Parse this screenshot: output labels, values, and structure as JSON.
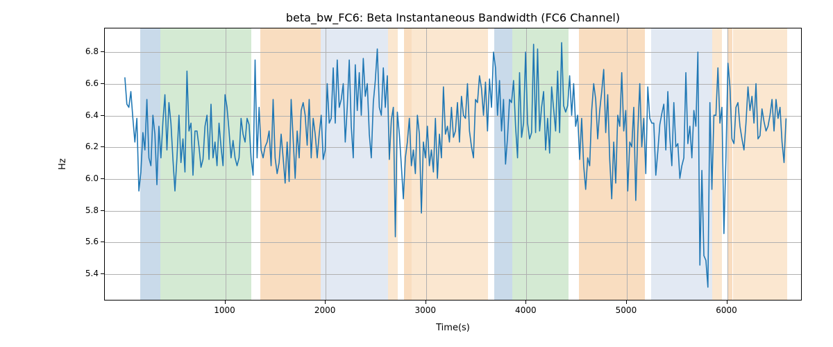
{
  "chart_data": {
    "type": "line",
    "title": "beta_bw_FC6: Beta Instantaneous Bandwidth (FC6 Channel)",
    "xlabel": "Time(s)",
    "ylabel": "Hz",
    "xlim": [
      -200,
      6750
    ],
    "ylim": [
      5.23,
      6.95
    ],
    "xticks": [
      1000,
      2000,
      3000,
      4000,
      5000,
      6000
    ],
    "yticks": [
      5.4,
      5.6,
      5.8,
      6.0,
      6.2,
      6.4,
      6.6,
      6.8
    ],
    "bands": [
      {
        "start": 150,
        "end": 350,
        "color": "#c9daea"
      },
      {
        "start": 350,
        "end": 1260,
        "color": "#d4ead3"
      },
      {
        "start": 1350,
        "end": 1950,
        "color": "#f9ddc0"
      },
      {
        "start": 1950,
        "end": 2620,
        "color": "#e2e9f3"
      },
      {
        "start": 2620,
        "end": 2720,
        "color": "#fbe7d0"
      },
      {
        "start": 2780,
        "end": 2860,
        "color": "#f9ddc0"
      },
      {
        "start": 2860,
        "end": 3620,
        "color": "#fbe7d0"
      },
      {
        "start": 3680,
        "end": 3860,
        "color": "#c9daea"
      },
      {
        "start": 3860,
        "end": 4420,
        "color": "#d4ead3"
      },
      {
        "start": 4520,
        "end": 5180,
        "color": "#f9ddc0"
      },
      {
        "start": 5240,
        "end": 5850,
        "color": "#e2e9f3"
      },
      {
        "start": 5850,
        "end": 5950,
        "color": "#fbe7d0"
      },
      {
        "start": 6010,
        "end": 6055,
        "color": "#f9ddc0"
      },
      {
        "start": 6055,
        "end": 6600,
        "color": "#fbe7d0"
      }
    ],
    "x": [
      0,
      20,
      40,
      60,
      80,
      100,
      120,
      140,
      160,
      180,
      200,
      220,
      240,
      260,
      280,
      300,
      320,
      340,
      360,
      380,
      400,
      420,
      440,
      460,
      480,
      500,
      520,
      540,
      560,
      580,
      600,
      620,
      640,
      660,
      680,
      700,
      720,
      740,
      760,
      780,
      800,
      820,
      840,
      860,
      880,
      900,
      920,
      940,
      960,
      980,
      1000,
      1020,
      1040,
      1060,
      1080,
      1100,
      1120,
      1140,
      1160,
      1180,
      1200,
      1220,
      1240,
      1260,
      1280,
      1300,
      1320,
      1340,
      1360,
      1380,
      1400,
      1420,
      1440,
      1460,
      1480,
      1500,
      1520,
      1540,
      1560,
      1580,
      1600,
      1620,
      1640,
      1660,
      1680,
      1700,
      1720,
      1740,
      1760,
      1780,
      1800,
      1820,
      1840,
      1860,
      1880,
      1900,
      1920,
      1940,
      1960,
      1980,
      2000,
      2020,
      2040,
      2060,
      2080,
      2100,
      2120,
      2140,
      2160,
      2180,
      2200,
      2220,
      2240,
      2260,
      2280,
      2300,
      2320,
      2340,
      2360,
      2380,
      2400,
      2420,
      2440,
      2460,
      2480,
      2500,
      2520,
      2540,
      2560,
      2580,
      2600,
      2620,
      2640,
      2660,
      2680,
      2700,
      2720,
      2740,
      2760,
      2780,
      2800,
      2820,
      2840,
      2860,
      2880,
      2900,
      2920,
      2940,
      2960,
      2980,
      3000,
      3020,
      3040,
      3060,
      3080,
      3100,
      3120,
      3140,
      3160,
      3180,
      3200,
      3220,
      3240,
      3260,
      3280,
      3300,
      3320,
      3340,
      3360,
      3380,
      3400,
      3420,
      3440,
      3460,
      3480,
      3500,
      3520,
      3540,
      3560,
      3580,
      3600,
      3620,
      3640,
      3660,
      3680,
      3700,
      3720,
      3740,
      3760,
      3780,
      3800,
      3820,
      3840,
      3860,
      3880,
      3900,
      3920,
      3940,
      3960,
      3980,
      4000,
      4020,
      4040,
      4060,
      4080,
      4100,
      4120,
      4140,
      4160,
      4180,
      4200,
      4220,
      4240,
      4260,
      4280,
      4300,
      4320,
      4340,
      4360,
      4380,
      4400,
      4420,
      4440,
      4460,
      4480,
      4500,
      4520,
      4540,
      4560,
      4580,
      4600,
      4620,
      4640,
      4660,
      4680,
      4700,
      4720,
      4740,
      4760,
      4780,
      4800,
      4820,
      4840,
      4860,
      4880,
      4900,
      4920,
      4940,
      4960,
      4980,
      5000,
      5020,
      5040,
      5060,
      5080,
      5100,
      5120,
      5140,
      5160,
      5180,
      5200,
      5220,
      5240,
      5260,
      5280,
      5300,
      5320,
      5340,
      5360,
      5380,
      5400,
      5420,
      5440,
      5460,
      5480,
      5500,
      5520,
      5540,
      5560,
      5580,
      5600,
      5620,
      5640,
      5660,
      5680,
      5700,
      5720,
      5740,
      5760,
      5780,
      5800,
      5820,
      5840,
      5860,
      5880,
      5900,
      5920,
      5940,
      5960,
      5980,
      6000,
      6020,
      6040,
      6060,
      6080,
      6100,
      6120,
      6140,
      6160,
      6180,
      6200,
      6220,
      6240,
      6260,
      6280,
      6300,
      6320,
      6340,
      6360,
      6380,
      6400,
      6420,
      6440,
      6460,
      6480,
      6500,
      6520,
      6540,
      6560,
      6580,
      6600
    ],
    "values": [
      6.64,
      6.47,
      6.45,
      6.55,
      6.38,
      6.23,
      6.38,
      5.92,
      6.04,
      6.29,
      6.18,
      6.5,
      6.13,
      6.08,
      6.4,
      6.28,
      5.96,
      6.33,
      6.13,
      6.36,
      6.53,
      6.18,
      6.48,
      6.35,
      6.12,
      5.92,
      6.13,
      6.4,
      6.1,
      6.25,
      6.04,
      6.68,
      6.3,
      6.35,
      6.02,
      6.3,
      6.3,
      6.2,
      6.07,
      6.12,
      6.33,
      6.4,
      6.12,
      6.47,
      6.13,
      6.23,
      6.08,
      6.35,
      6.2,
      6.08,
      6.53,
      6.45,
      6.3,
      6.13,
      6.24,
      6.13,
      6.08,
      6.13,
      6.38,
      6.28,
      6.23,
      6.38,
      6.34,
      6.13,
      6.02,
      6.75,
      6.13,
      6.45,
      6.18,
      6.13,
      6.2,
      6.23,
      6.3,
      6.08,
      6.5,
      6.13,
      6.03,
      6.1,
      6.28,
      6.13,
      5.97,
      6.23,
      5.98,
      6.5,
      6.25,
      6.0,
      6.3,
      6.13,
      6.43,
      6.48,
      6.4,
      6.21,
      6.5,
      6.13,
      6.38,
      6.28,
      6.13,
      6.28,
      6.4,
      6.12,
      6.18,
      6.6,
      6.35,
      6.38,
      6.7,
      6.35,
      6.75,
      6.45,
      6.5,
      6.6,
      6.23,
      6.45,
      6.75,
      6.33,
      6.13,
      6.72,
      6.43,
      6.67,
      6.4,
      6.76,
      6.52,
      6.6,
      6.28,
      6.13,
      6.48,
      6.62,
      6.82,
      6.45,
      6.4,
      6.7,
      6.45,
      6.65,
      6.12,
      6.37,
      6.45,
      5.63,
      6.42,
      6.28,
      6.08,
      5.87,
      6.13,
      6.23,
      6.38,
      6.08,
      6.18,
      6.03,
      6.4,
      6.28,
      5.78,
      6.23,
      6.13,
      6.33,
      6.08,
      6.18,
      6.04,
      6.38,
      6.0,
      6.28,
      6.13,
      6.58,
      6.28,
      6.33,
      6.23,
      6.45,
      6.26,
      6.3,
      6.48,
      6.23,
      6.52,
      6.4,
      6.38,
      6.6,
      6.3,
      6.2,
      6.13,
      6.5,
      6.48,
      6.65,
      6.57,
      6.4,
      6.61,
      6.3,
      6.63,
      6.45,
      6.8,
      6.7,
      6.4,
      6.62,
      6.3,
      6.5,
      6.09,
      6.26,
      6.5,
      6.48,
      6.62,
      6.33,
      6.13,
      6.67,
      6.26,
      6.35,
      6.8,
      6.35,
      6.25,
      6.29,
      6.85,
      6.29,
      6.82,
      6.3,
      6.45,
      6.55,
      6.18,
      6.38,
      6.16,
      6.58,
      6.44,
      6.3,
      6.68,
      6.29,
      6.86,
      6.46,
      6.42,
      6.46,
      6.65,
      6.4,
      6.6,
      6.33,
      6.4,
      6.12,
      6.38,
      6.08,
      5.93,
      6.13,
      6.08,
      6.43,
      6.6,
      6.5,
      6.25,
      6.43,
      6.55,
      6.69,
      6.29,
      6.53,
      6.12,
      5.87,
      6.23,
      5.97,
      6.4,
      6.33,
      6.67,
      6.3,
      6.43,
      5.92,
      6.23,
      6.2,
      6.45,
      5.86,
      6.29,
      6.6,
      6.2,
      6.38,
      6.03,
      6.58,
      6.38,
      6.35,
      6.35,
      6.02,
      6.17,
      6.34,
      6.41,
      6.47,
      6.18,
      6.55,
      6.26,
      6.08,
      6.48,
      6.2,
      6.22,
      6.0,
      6.08,
      6.13,
      6.67,
      6.22,
      6.33,
      6.13,
      6.43,
      6.33,
      6.8,
      5.45,
      6.05,
      5.51,
      5.48,
      5.31,
      6.48,
      5.93,
      6.4,
      6.4,
      6.7,
      6.35,
      6.45,
      5.65,
      6.13,
      6.73,
      6.58,
      6.25,
      6.22,
      6.45,
      6.48,
      6.33,
      6.25,
      6.18,
      6.35,
      6.58,
      6.43,
      6.52,
      6.35,
      6.6,
      6.25,
      6.27,
      6.44,
      6.36,
      6.3,
      6.33,
      6.4,
      6.5,
      6.3,
      6.5,
      6.38,
      6.45,
      6.23,
      6.1,
      6.38
    ]
  }
}
